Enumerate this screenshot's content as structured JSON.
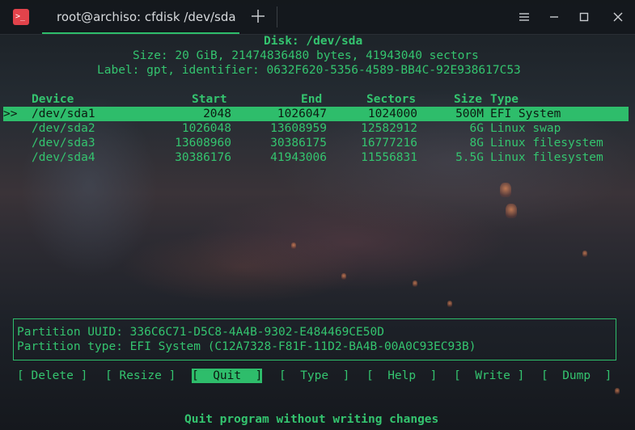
{
  "window": {
    "tab_title": "root@archiso: cfdisk /dev/sda",
    "app_icon_glyph": ">_"
  },
  "disk": {
    "title": "Disk: /dev/sda",
    "size_line": "Size: 20 GiB, 21474836480 bytes, 41943040 sectors",
    "label_line": "Label: gpt, identifier: 0632F620-5356-4589-BB4C-92E938617C53"
  },
  "table": {
    "headers": {
      "device": "Device",
      "start": "Start",
      "end": "End",
      "sectors": "Sectors",
      "size": "Size",
      "type": "Type"
    },
    "selection_marker": ">>",
    "rows": [
      {
        "device": "/dev/sda1",
        "start": "2048",
        "end": "1026047",
        "sectors": "1024000",
        "size": "500M",
        "type": "EFI System"
      },
      {
        "device": "/dev/sda2",
        "start": "1026048",
        "end": "13608959",
        "sectors": "12582912",
        "size": "6G",
        "type": "Linux swap"
      },
      {
        "device": "/dev/sda3",
        "start": "13608960",
        "end": "30386175",
        "sectors": "16777216",
        "size": "8G",
        "type": "Linux filesystem"
      },
      {
        "device": "/dev/sda4",
        "start": "30386176",
        "end": "41943006",
        "sectors": "11556831",
        "size": "5.5G",
        "type": "Linux filesystem"
      }
    ]
  },
  "details": {
    "uuid_line": "Partition UUID: 336C6C71-D5C8-4A4B-9302-E484469CE50D",
    "type_line": "Partition type: EFI System (C12A7328-F81F-11D2-BA4B-00A0C93EC93B)"
  },
  "menu": {
    "delete": "[ Delete ]",
    "resize": "[ Resize ]",
    "quit": "[  Quit  ]",
    "type": "[  Type  ]",
    "help": "[  Help  ]",
    "write": "[  Write ]",
    "dump": "[  Dump  ]"
  },
  "status_hint": "Quit program without writing changes",
  "colors": {
    "accent": "#2ebd6b",
    "terminal_text": "#34c46f",
    "icon_red": "#e2434b"
  }
}
